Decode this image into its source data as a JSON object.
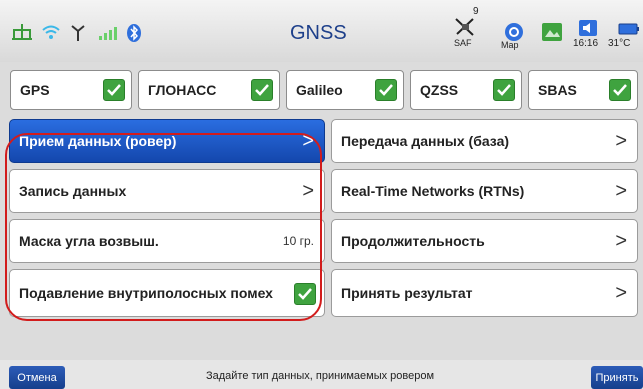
{
  "statusbar": {
    "title": "GNSS",
    "satellite_count": "9",
    "satellite_sub": "SAF",
    "map_label": "Map",
    "time": "16:16",
    "temp": "31°C",
    "icons": [
      "network-icon",
      "wifi-icon",
      "antenna-icon",
      "signal-icon",
      "bluetooth-icon",
      "satellite-icon",
      "map-icon",
      "photo-icon",
      "volume-icon",
      "battery-icon"
    ]
  },
  "gnss_tabs": [
    {
      "label": "GPS",
      "checked": true
    },
    {
      "label": "ГЛОНАСС",
      "checked": true
    },
    {
      "label": "Galileo",
      "checked": true
    },
    {
      "label": "QZSS",
      "checked": true
    },
    {
      "label": "SBAS",
      "checked": true
    }
  ],
  "left_menu": [
    {
      "label": "Прием данных (ровер)",
      "suffix": ">",
      "active": true
    },
    {
      "label": "Запись данных",
      "suffix": ">"
    },
    {
      "label": "Маска угла возвыш.",
      "value": "10 гр."
    },
    {
      "label": "Подавление внутриполосных помех",
      "checked": true
    }
  ],
  "right_menu": [
    {
      "label": "Передача данных (база)",
      "suffix": ">"
    },
    {
      "label": "Real-Time Networks (RTNs)",
      "suffix": ">"
    },
    {
      "label": "Продолжительность",
      "suffix": ">"
    },
    {
      "label": "Принять результат",
      "suffix": ">"
    }
  ],
  "bottombar": {
    "cancel_label": "Отмена",
    "hint": "Задайте тип данных, принимаемых ровером",
    "accept_label": "Принять"
  },
  "colors": {
    "accent": "#1d57c7",
    "check": "#3fa33f",
    "annotation": "#d21c1c"
  }
}
